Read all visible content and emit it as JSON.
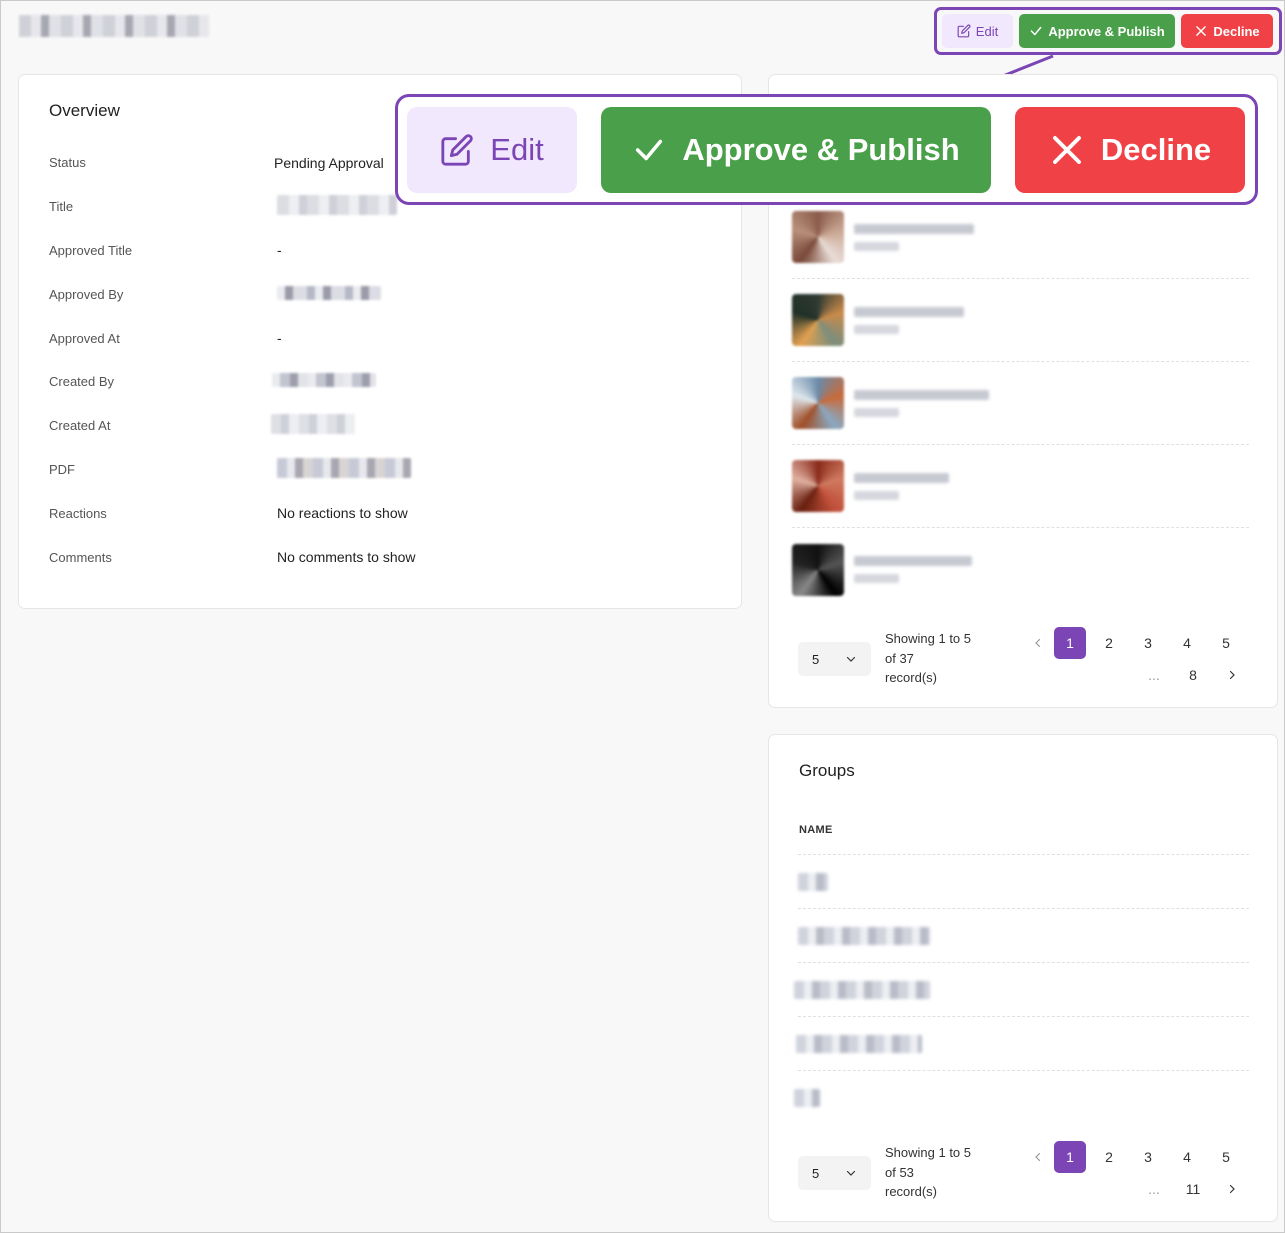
{
  "toolbar": {
    "edit_label": "Edit",
    "approve_label": "Approve & Publish",
    "decline_label": "Decline"
  },
  "colors": {
    "accent": "#7b45b5",
    "approve": "#4aa04a",
    "decline": "#ef4146",
    "edit_bg": "#f1e8fd"
  },
  "overview": {
    "title": "Overview",
    "rows": [
      {
        "label": "Status",
        "value": "Pending Approval"
      },
      {
        "label": "Title",
        "value": ""
      },
      {
        "label": "Approved Title",
        "value": "-"
      },
      {
        "label": "Approved By",
        "value": ""
      },
      {
        "label": "Approved At",
        "value": "-"
      },
      {
        "label": "Created By",
        "value": ""
      },
      {
        "label": "Created At",
        "value": ""
      },
      {
        "label": "PDF",
        "value": ""
      },
      {
        "label": "Reactions",
        "value": "No reactions to show"
      },
      {
        "label": "Comments",
        "value": "No comments to show"
      }
    ]
  },
  "members": {
    "pagination": {
      "per_page": "5",
      "showing_line1": "Showing 1 to 5",
      "showing_line2": "of 37",
      "showing_line3": "record(s)",
      "pages": [
        "1",
        "2",
        "3",
        "4",
        "5"
      ],
      "ellipsis": "...",
      "last_page": "8"
    }
  },
  "groups": {
    "title": "Groups",
    "column": "NAME",
    "pagination": {
      "per_page": "5",
      "showing_line1": "Showing 1 to 5",
      "showing_line2": "of 53",
      "showing_line3": "record(s)",
      "pages": [
        "1",
        "2",
        "3",
        "4",
        "5"
      ],
      "ellipsis": "...",
      "last_page": "11"
    }
  },
  "icons": {
    "edit": "pencil-square-icon",
    "approve": "check-icon",
    "decline": "x-icon",
    "per_page": "chevron-down-icon",
    "prev": "chevron-left-icon",
    "next": "chevron-right-icon"
  }
}
